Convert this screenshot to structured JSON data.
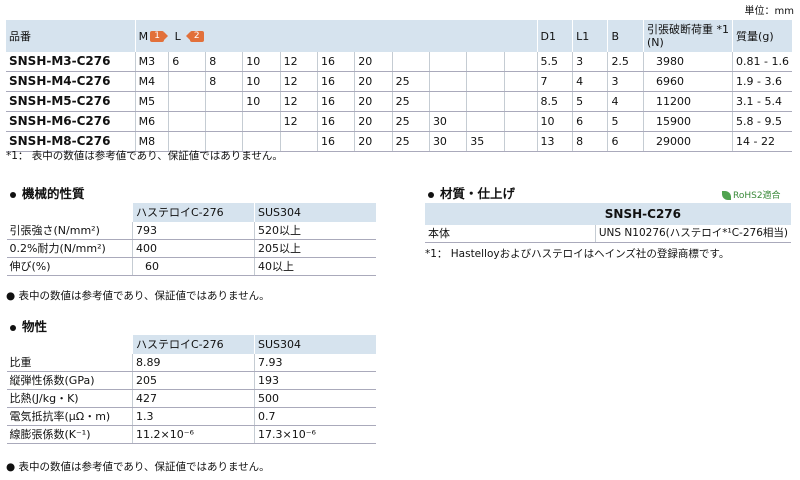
{
  "unit_label": "単位：mm",
  "main": {
    "headers": {
      "name": "品番",
      "m": "M",
      "m_badge": "1",
      "l": "L",
      "l_badge": "2",
      "d1": "D1",
      "l1": "L1",
      "b": "B",
      "tensile": "引張破断荷重 *1",
      "tensile_unit": "(N)",
      "mass": "質量(g)"
    },
    "rows": [
      {
        "name": "SNSH-M3-C276",
        "m": "M3",
        "l": [
          "6",
          "8",
          "10",
          "12",
          "16",
          "20",
          "",
          "",
          "",
          ""
        ],
        "d1": "5.5",
        "l1": "3",
        "b": "2.5",
        "tensile": "3980",
        "mass": "0.81 -  1.6"
      },
      {
        "name": "SNSH-M4-C276",
        "m": "M4",
        "l": [
          "",
          "8",
          "10",
          "12",
          "16",
          "20",
          "25",
          "",
          "",
          ""
        ],
        "d1": "7",
        "l1": "4",
        "b": "3",
        "tensile": "6960",
        "mass": "1.9  -  3.6"
      },
      {
        "name": "SNSH-M5-C276",
        "m": "M5",
        "l": [
          "",
          "",
          "10",
          "12",
          "16",
          "20",
          "25",
          "",
          "",
          ""
        ],
        "d1": "8.5",
        "l1": "5",
        "b": "4",
        "tensile": "11200",
        "mass": "3.1  -  5.4"
      },
      {
        "name": "SNSH-M6-C276",
        "m": "M6",
        "l": [
          "",
          "",
          "",
          "12",
          "16",
          "20",
          "25",
          "30",
          "",
          ""
        ],
        "d1": "10",
        "l1": "6",
        "b": "5",
        "tensile": "15900",
        "mass": "5.8  -  9.5"
      },
      {
        "name": "SNSH-M8-C276",
        "m": "M8",
        "l": [
          "",
          "",
          "",
          "",
          "16",
          "20",
          "25",
          "30",
          "35",
          ""
        ],
        "d1": "13",
        "l1": "8",
        "b": "6",
        "tensile": "29000",
        "mass": "14    - 22"
      }
    ],
    "note": "*1：  表中の数値は参考値であり、保証値ではありません。"
  },
  "mech": {
    "title": "機械的性質",
    "cols": [
      "",
      "ハステロイC-276",
      "SUS304"
    ],
    "rows": [
      [
        "引張強さ(N/mm²)",
        "793",
        "520以上"
      ],
      [
        "0.2%耐力(N/mm²)",
        "400",
        "205以上"
      ],
      [
        "伸び(%)",
        "60",
        "40以上"
      ]
    ],
    "note": "● 表中の数値は参考値であり、保証値ではありません。"
  },
  "phys": {
    "title": "物性",
    "cols": [
      "",
      "ハステロイC-276",
      "SUS304"
    ],
    "rows": [
      [
        "比重",
        "8.89",
        "7.93"
      ],
      [
        "縦弾性係数(GPa)",
        "205",
        "193"
      ],
      [
        "比熱(J/kg・K)",
        "427",
        "500"
      ],
      [
        "電気抵抗率(μΩ・m)",
        "1.3",
        "0.7"
      ],
      [
        "線膨張係数(K⁻¹)",
        "11.2×10⁻⁶",
        "17.3×10⁻⁶"
      ]
    ],
    "note": "● 表中の数値は参考値であり、保証値ではありません。"
  },
  "material": {
    "title": "材質・仕上げ",
    "rohs": "RoHS2適合",
    "header": "SNSH-C276",
    "row_label": "本体",
    "row_value": "UNS N10276(ハステロイ*¹C-276相当)",
    "note": "*1：  Hastelloyおよびハステロイはヘインズ社の登録商標です。"
  },
  "colors": {
    "header_bg": "#d6e3ee",
    "badge": "#e2703a",
    "rohs": "#3a8a3a"
  }
}
